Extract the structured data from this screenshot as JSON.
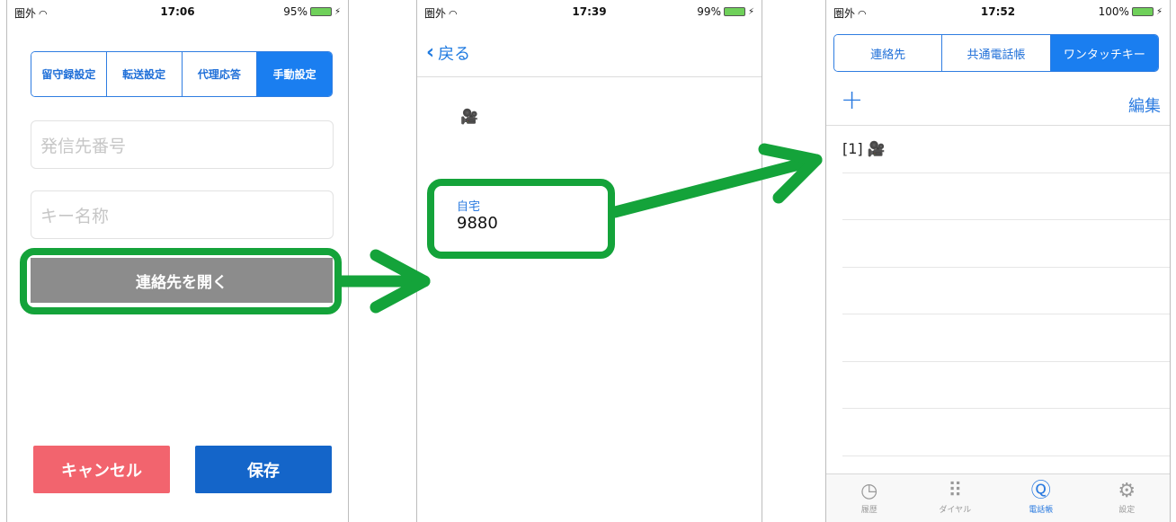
{
  "phone1": {
    "status": {
      "carrier": "圏外",
      "time": "17:06",
      "battery": "95%"
    },
    "tabs": [
      {
        "label": "留守録設定",
        "active": false
      },
      {
        "label": "転送設定",
        "active": false
      },
      {
        "label": "代理応答",
        "active": false
      },
      {
        "label": "手動設定",
        "active": true
      }
    ],
    "number_placeholder": "発信先番号",
    "keyname_placeholder": "キー名称",
    "open_contacts_label": "連絡先を開く",
    "cancel_label": "キャンセル",
    "save_label": "保存"
  },
  "phone2": {
    "status": {
      "carrier": "圏外",
      "time": "17:39",
      "battery": "99%"
    },
    "back_label": "戻る",
    "contact_icon": "camera-icon",
    "phone_label": "自宅",
    "phone_number": "9880"
  },
  "phone3": {
    "status": {
      "carrier": "圏外",
      "time": "17:52",
      "battery": "100%"
    },
    "tabs": [
      {
        "label": "連絡先",
        "active": false
      },
      {
        "label": "共通電話帳",
        "active": false
      },
      {
        "label": "ワンタッチキー",
        "active": true
      }
    ],
    "edit_label": "編集",
    "rows": [
      "[1]",
      "",
      "",
      "",
      "",
      "",
      ""
    ],
    "tabbar": [
      {
        "label": "履歴",
        "icon": "clock-icon",
        "active": false
      },
      {
        "label": "ダイヤル",
        "icon": "keypad-icon",
        "active": false
      },
      {
        "label": "電話帳",
        "icon": "contacts-icon",
        "active": true
      },
      {
        "label": "設定",
        "icon": "gear-icon",
        "active": false
      }
    ]
  },
  "colors": {
    "accent": "#1a7ef0",
    "highlight": "#14a33a",
    "cancel": "#f2646e",
    "save": "#1465c9"
  }
}
